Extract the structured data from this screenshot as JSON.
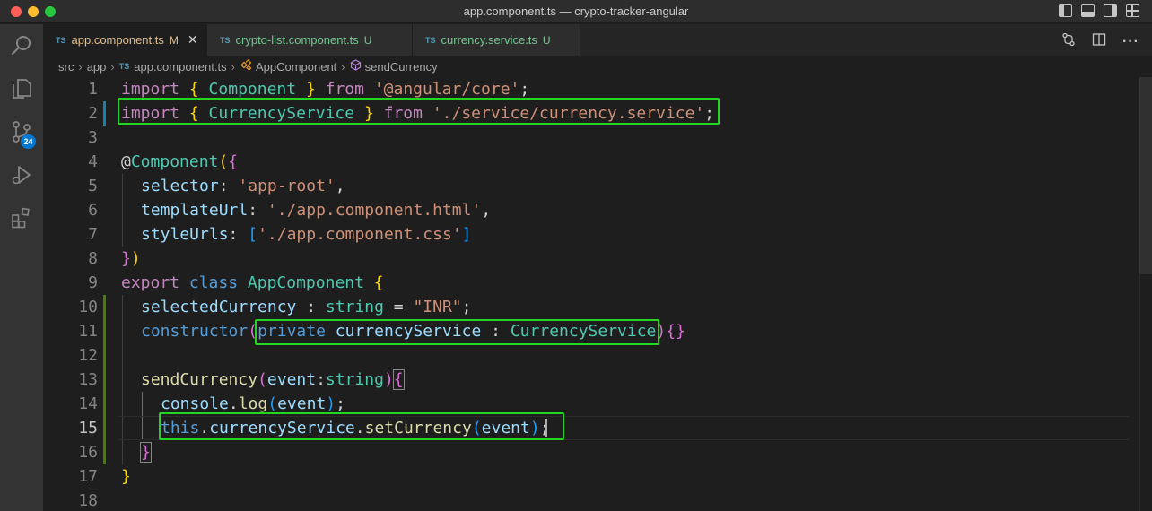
{
  "window": {
    "title": "app.component.ts — crypto-tracker-angular"
  },
  "activity_bar": {
    "items": [
      {
        "name": "search-icon"
      },
      {
        "name": "explorer-icon"
      },
      {
        "name": "source-control-icon",
        "badge": "24"
      },
      {
        "name": "run-debug-icon"
      },
      {
        "name": "extensions-icon"
      }
    ]
  },
  "tabs": [
    {
      "lang": "TS",
      "label": "app.component.ts",
      "status": "M",
      "active": true
    },
    {
      "lang": "TS",
      "label": "crypto-list.component.ts",
      "status": "U",
      "active": false
    },
    {
      "lang": "TS",
      "label": "currency.service.ts",
      "status": "U",
      "active": false
    }
  ],
  "breadcrumb": {
    "items": [
      "src",
      "app",
      "app.component.ts",
      "AppComponent",
      "sendCurrency"
    ],
    "file_lang": "TS"
  },
  "editor": {
    "line_numbers": [
      "1",
      "2",
      "3",
      "4",
      "5",
      "6",
      "7",
      "8",
      "9",
      "10",
      "11",
      "12",
      "13",
      "14",
      "15",
      "16",
      "17",
      "18"
    ],
    "current_line": "15",
    "lines": [
      [
        "import",
        " ",
        "{",
        " Component ",
        "}",
        " from ",
        "'@angular/core'",
        ";"
      ],
      [
        "import",
        " ",
        "{",
        " CurrencyService ",
        "}",
        " from ",
        "'./service/currency.service'",
        ";"
      ],
      [],
      [
        "@",
        "Component",
        "(",
        "{"
      ],
      [
        "selector",
        ": ",
        "'app-root'",
        ","
      ],
      [
        "templateUrl",
        ": ",
        "'./app.component.html'",
        ","
      ],
      [
        "styleUrls",
        ": ",
        "[",
        "'./app.component.css'",
        "]"
      ],
      [
        "}",
        ")"
      ],
      [
        "export",
        " ",
        "class",
        " ",
        "AppComponent",
        " ",
        "{"
      ],
      [
        "selectedCurrency",
        " : ",
        "string",
        " = ",
        "\"INR\"",
        ";"
      ],
      [
        "constructor",
        "(",
        "private",
        " ",
        "currencyService",
        " : ",
        "CurrencyService",
        ")",
        "{}"
      ],
      [],
      [
        "sendCurrency",
        "(",
        "event",
        ":",
        "string",
        ")",
        "{"
      ],
      [
        "console",
        ".",
        "log",
        "(",
        "event",
        ")",
        ";"
      ],
      [
        "this",
        ".",
        "currencyService",
        ".",
        "setCurrency",
        "(",
        "event",
        ")",
        ";"
      ],
      [
        "}"
      ],
      [
        "}"
      ],
      []
    ]
  },
  "colors": {
    "highlight_box": "#22d622",
    "keyword": "#569cd6",
    "import_keyword": "#c586c0",
    "class": "#4ec9b0",
    "string": "#ce9178",
    "property": "#9cdcfe",
    "function": "#dcdcaa"
  }
}
